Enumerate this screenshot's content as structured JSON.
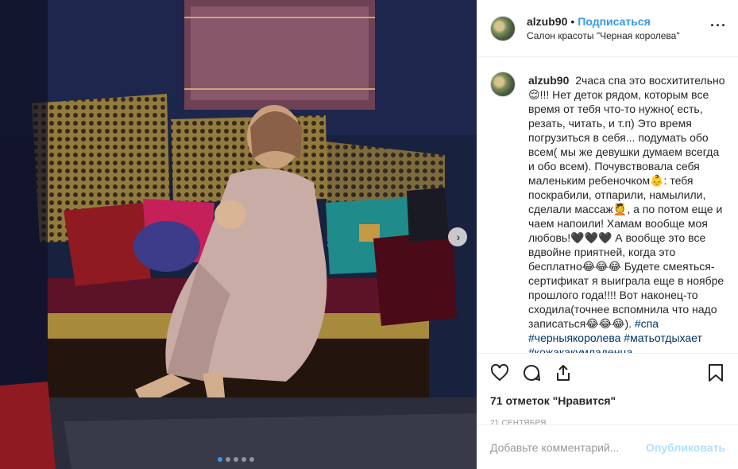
{
  "post": {
    "username": "alzub90",
    "separator": "•",
    "follow_label": "Подписаться",
    "location": "Салон красоты \"Черная королева\"",
    "more_icon": "more-horizontal-icon"
  },
  "caption": {
    "username": "alzub90",
    "text": "2часа спа это восхитительно 😌!!! Нет деток рядом, которым все время от тебя что-то нужно( есть, резать, читать, и т.п) Это время погрузиться в себя... подумать обо всем( мы же девушки думаем всегда и обо всем). Почувствовала себя маленьким ребеночком👶: тебя поскрабили, отпарили, намылили, сделали массаж💆, а по потом еще и чаем напоили! Хамам вообще моя любовь!🖤🖤🖤 А вообще это все вдвойне приятней, когда это бесплатно😂😂😂 Будете смеяться- сертификат я выиграла еще в ноябре прошлого года!!!! Вот наконец-то сходила(точнее вспомнила что надо записаться😂😂😂).",
    "hashtags": [
      "#спа",
      "#черныякоролева",
      "#матьотдыхает",
      "#кожакакумладенца"
    ]
  },
  "actions": {
    "like_icon": "heart-icon",
    "comment_icon": "comment-icon",
    "share_icon": "share-icon",
    "save_icon": "bookmark-icon"
  },
  "likes_text": "71 отметок \"Нравится\"",
  "date_text": "21 сентября",
  "comment_form": {
    "placeholder": "Добавьте комментарий...",
    "publish_label": "Опубликовать"
  },
  "carousel": {
    "next_icon": "chevron-right-icon",
    "slide_count": 5,
    "active_index": 0
  },
  "colors": {
    "accent": "#3897f0",
    "publish_disabled": "#b2dffc",
    "hashtag": "#003569"
  }
}
